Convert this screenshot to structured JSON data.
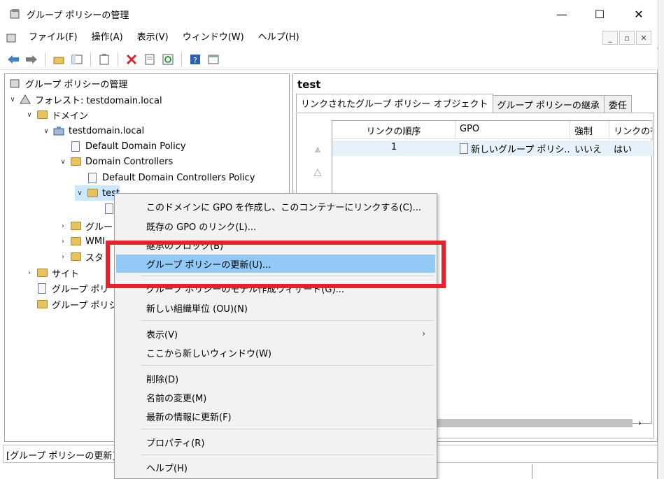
{
  "window": {
    "title": "グループ ポリシーの管理",
    "minimize": "—",
    "maximize": "☐",
    "close": "✕"
  },
  "menubar": [
    "ファイル(F)",
    "操作(A)",
    "表示(V)",
    "ウィンドウ(W)",
    "ヘルプ(H)"
  ],
  "mdi_controls": [
    "_",
    "▫",
    "✕"
  ],
  "tree": {
    "root": "グループ ポリシーの管理",
    "forest": "フォレスト: testdomain.local",
    "domains": "ドメイン",
    "domain": "testdomain.local",
    "default_policy": "Default Domain Policy",
    "domain_controllers": "Domain Controllers",
    "ddc_policy": "Default Domain Controllers Policy",
    "test_ou": "test",
    "gpo_objects": "グルー",
    "wmi": "WMI",
    "starter": "スタ",
    "sites": "サイト",
    "modeling": "グループ ポリ",
    "results": "グループ ポリシ"
  },
  "right_pane": {
    "title": "test",
    "tabs": [
      "リンクされたグループ ポリシー オブジェクト",
      "グループ ポリシーの継承",
      "委任"
    ],
    "columns": [
      "リンクの順序",
      "GPO",
      "強制",
      "リンクの有"
    ],
    "rows": [
      {
        "order": "1",
        "gpo": "新しいグループ ポリシ...",
        "enforced": "いいえ",
        "enabled": "はい"
      }
    ]
  },
  "status_bar": "[グループ ポリシーの更新] フ",
  "context_menu": {
    "items": [
      "このドメインに GPO を作成し、このコンテナーにリンクする(C)...",
      "既存の GPO のリンク(L)...",
      "継承のブロック(B)",
      "グループ ポリシーの更新(U)...",
      "グループ ポリシーのモデル作成ウィザード(G)...",
      "新しい組織単位 (OU)(N)",
      "表示(V)",
      "ここから新しいウィンドウ(W)",
      "削除(D)",
      "名前の変更(M)",
      "最新の情報に更新(F)",
      "プロパティ(R)",
      "ヘルプ(H)"
    ],
    "highlight_color": "#91c9f7",
    "annotation_color": "#e8202a"
  }
}
